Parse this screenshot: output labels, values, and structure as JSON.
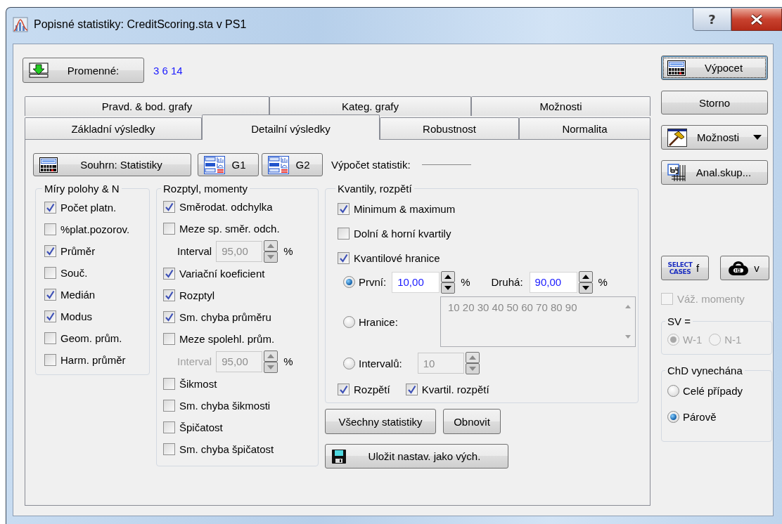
{
  "window": {
    "title": "Popisné statistiky: CreditScoring.sta v PS1",
    "help": "?"
  },
  "variables": {
    "button": "Promenné:",
    "value": "3 6 14"
  },
  "tab_rows": [
    {
      "tabs": [
        {
          "label": "Pravd. & bod. grafy",
          "selected": false
        },
        {
          "label": "Kateg. grafy",
          "selected": false
        },
        {
          "label": "Možnosti",
          "selected": false
        }
      ]
    },
    {
      "tabs": [
        {
          "label": "Základní výsledky",
          "selected": false
        },
        {
          "label": "Detailní výsledky",
          "selected": true
        },
        {
          "label": "Robustnost",
          "selected": false
        },
        {
          "label": "Normalita",
          "selected": false
        }
      ]
    }
  ],
  "panel_buttons": [
    {
      "label": "Souhrn: Statistiky",
      "kind": "summary"
    },
    {
      "label": "G1",
      "kind": "graph"
    },
    {
      "label": "G2",
      "kind": "graph"
    }
  ],
  "status_label": "Výpočet statistik:",
  "groups": [
    {
      "title": "Míry polohy & N",
      "items": [
        {
          "kind": "checkbox",
          "label": "Počet platn.",
          "checked": true
        },
        {
          "kind": "checkbox",
          "label": "%plat.pozorov.",
          "checked": false
        },
        {
          "kind": "checkbox",
          "label": "Průměr",
          "checked": true
        },
        {
          "kind": "checkbox",
          "label": "Souč.",
          "checked": false
        },
        {
          "kind": "checkbox",
          "label": "Medián",
          "checked": true
        },
        {
          "kind": "checkbox",
          "label": "Modus",
          "checked": true
        },
        {
          "kind": "checkbox",
          "label": "Geom. prům.",
          "checked": false
        },
        {
          "kind": "checkbox",
          "label": "Harm. průměr",
          "checked": false
        }
      ]
    },
    {
      "title": "Rozptyl, momenty",
      "items": [
        {
          "kind": "checkbox",
          "label": "Směrodat. odchylka",
          "checked": true
        },
        {
          "kind": "checkbox",
          "label": "Meze sp. směr. odch.",
          "checked": false
        },
        {
          "kind": "interval",
          "label": "Interval",
          "value": "95,00",
          "unit": "%",
          "disabled": false
        },
        {
          "kind": "checkbox",
          "label": "Variační koeficient",
          "checked": true
        },
        {
          "kind": "checkbox",
          "label": "Rozptyl",
          "checked": true
        },
        {
          "kind": "checkbox",
          "label": "Sm. chyba průměru",
          "checked": true
        },
        {
          "kind": "checkbox",
          "label": "Meze spolehl. prům.",
          "checked": false
        },
        {
          "kind": "interval",
          "label": "Interval",
          "value": "95,00",
          "unit": "%",
          "disabled": true
        },
        {
          "kind": "checkbox",
          "label": "Šikmost",
          "checked": false
        },
        {
          "kind": "checkbox",
          "label": "Sm. chyba šikmosti",
          "checked": false
        },
        {
          "kind": "checkbox",
          "label": "Špičatost",
          "checked": false
        },
        {
          "kind": "checkbox",
          "label": "Sm. chyba špičatost",
          "checked": false
        }
      ]
    },
    {
      "title": "Kvantily, rozpětí",
      "items": [
        {
          "kind": "checkbox",
          "label": "Minimum & maximum",
          "checked": true
        },
        {
          "kind": "checkbox",
          "label": "Dolní & horní kvartily",
          "checked": false
        },
        {
          "kind": "checkbox",
          "label": "Kvantilové hranice",
          "checked": true
        },
        {
          "kind": "radio-pair",
          "label": "První:",
          "selected": true,
          "value": "10,00",
          "unit": "%",
          "label2": "Druhá:",
          "value2": "90,00",
          "unit2": "%"
        },
        {
          "kind": "radio-list",
          "label": "Hranice:",
          "selected": false,
          "value": "10 20 30 40 50 60 70 80 90"
        },
        {
          "kind": "radio-spin",
          "label": "Intervalů:",
          "selected": false,
          "value": "10"
        },
        {
          "kind": "checkbox-row",
          "items": [
            {
              "label": "Rozpětí",
              "checked": true
            },
            {
              "label": "Kvartil. rozpětí",
              "checked": true
            }
          ]
        }
      ]
    }
  ],
  "actions": [
    {
      "label": "Všechny statistiky",
      "kind": "plain"
    },
    {
      "label": "Obnovit",
      "kind": "plain"
    },
    {
      "label": "Uložit nastav. jako vých.",
      "kind": "save"
    }
  ],
  "side_buttons": [
    {
      "label": "Výpocet",
      "kind": "compute",
      "focused": true
    },
    {
      "label": "Storno",
      "kind": "plain",
      "focused": false
    },
    {
      "label": "Možnosti",
      "kind": "menu",
      "focused": false
    },
    {
      "label": "Anal.skup...",
      "kind": "by-group",
      "focused": false
    }
  ],
  "tool_buttons": [
    {
      "label": "f",
      "kind": "select-cases",
      "icon_text": "SELECT CASES"
    },
    {
      "label": "v",
      "kind": "weight"
    }
  ],
  "weights": {
    "label": "Váž. momenty",
    "checked": false,
    "disabled": true
  },
  "sv": {
    "title": "SV =",
    "options": [
      {
        "label": "W-1",
        "selected": true,
        "disabled": true
      },
      {
        "label": "N-1",
        "selected": false,
        "disabled": true
      }
    ]
  },
  "missing_data": {
    "title": "ChD vynechána",
    "options": [
      {
        "label": "Celé případy",
        "selected": false,
        "disabled": false
      },
      {
        "label": "Párově",
        "selected": true,
        "disabled": false
      }
    ]
  }
}
